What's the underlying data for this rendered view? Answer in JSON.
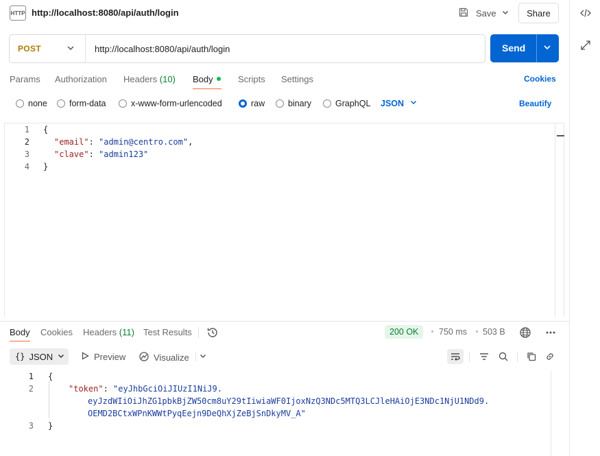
{
  "request": {
    "title": "http://localhost:8080/api/auth/login",
    "icon": "http-icon",
    "save_label": "Save",
    "share_label": "Share",
    "method": "POST",
    "url": "http://localhost:8080/api/auth/login",
    "send_label": "Send"
  },
  "tabs": [
    {
      "label": "Params"
    },
    {
      "label": "Authorization"
    },
    {
      "label": "Headers",
      "count": "(10)"
    },
    {
      "label": "Body",
      "active": true
    },
    {
      "label": "Scripts"
    },
    {
      "label": "Settings"
    }
  ],
  "cookies_label": "Cookies",
  "body_types": {
    "options": [
      "none",
      "form-data",
      "x-www-form-urlencoded",
      "raw",
      "binary",
      "GraphQL"
    ],
    "selected": "raw",
    "language": "JSON",
    "beautify_label": "Beautify"
  },
  "request_body": {
    "line_numbers": [
      "1",
      "2",
      "3",
      "4"
    ],
    "lines": [
      "{",
      "\"email\": \"admin@centro.com\",",
      "\"clave\": \"admin123\"",
      "}"
    ],
    "key_email": "\"email\"",
    "val_email": "\"admin@centro.com\"",
    "key_clave": "\"clave\"",
    "val_clave": "\"admin123\""
  },
  "response": {
    "tabs": [
      {
        "label": "Body",
        "active": true
      },
      {
        "label": "Cookies"
      },
      {
        "label": "Headers",
        "count": "(11)"
      },
      {
        "label": "Test Results"
      }
    ],
    "status": "200 OK",
    "time": "750 ms",
    "size": "503 B",
    "format": "JSON",
    "preview_label": "Preview",
    "visualize_label": "Visualize",
    "line_numbers": [
      "1",
      "2",
      "3"
    ],
    "open_brace": "{",
    "close_brace": "}",
    "token_key": "\"token\"",
    "token_part1": "\"eyJhbGciOiJIUzI1NiJ9.",
    "token_part2": "eyJzdWIiOiJhZG1pbkBjZW50cm8uY29tIiwiaWF0IjoxNzQ3NDc5MTQ3LCJleHAiOjE3NDc1NjU1NDd9.",
    "token_part3": "OEMD2BCtxWPnKWWtPyqEejn9DeQhXjZeBjSnDkyMV_A\""
  },
  "colors": {
    "accent_blue": "#0265d2",
    "method_post": "#ad7a03",
    "active_tab_underline": "#ff6c37",
    "status_ok": "#0a7d2e"
  }
}
